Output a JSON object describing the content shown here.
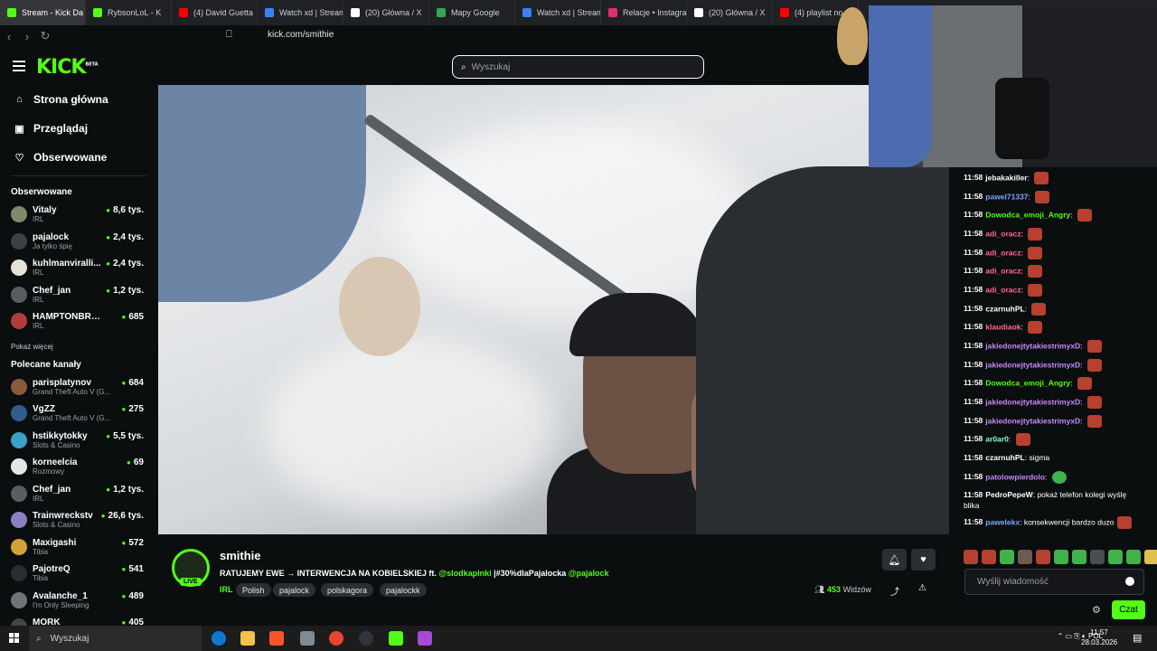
{
  "browser": {
    "tabs": [
      {
        "label": "Stream - Kick Da",
        "color": "#53fc18",
        "active": true
      },
      {
        "label": "RybsonLoL - K",
        "color": "#53fc18"
      },
      {
        "label": "(4) David Guetta",
        "color": "#ff0000"
      },
      {
        "label": "Watch xd | Stream",
        "color": "#3b82f6"
      },
      {
        "label": "(20) Główna / X",
        "color": "#ffffff"
      },
      {
        "label": "Mapy Google",
        "color": "#34a853"
      },
      {
        "label": "Watch xd | Stream",
        "color": "#3b82f6"
      },
      {
        "label": "Relacje • Instagram",
        "color": "#e1306c"
      },
      {
        "label": "(20) Główna / X",
        "color": "#ffffff"
      },
      {
        "label": "(4) playlist no",
        "color": "#ff0000"
      }
    ],
    "url": "kick.com/smithie"
  },
  "header": {
    "logo": "KICK",
    "logo_badge": "BETA",
    "search_placeholder": "Wyszukaj"
  },
  "sidebar": {
    "nav": [
      {
        "label": "Strona główna",
        "icon": "home-icon"
      },
      {
        "label": "Przeglądaj",
        "icon": "browse-icon"
      },
      {
        "label": "Obserwowane",
        "icon": "heart-icon"
      }
    ],
    "following_title": "Obserwowane",
    "following": [
      {
        "name": "Vitaly",
        "sub": "IRL",
        "viewers": "8,6 tys.",
        "color": "#7d8a6e"
      },
      {
        "name": "pajalock",
        "sub": "Ja tylko śpię",
        "viewers": "2,4 tys.",
        "color": "#3d3f44"
      },
      {
        "name": "kuhlmanviralli...",
        "sub": "IRL",
        "viewers": "2,4 tys.",
        "color": "#e8e2d6"
      },
      {
        "name": "Chef_jan",
        "sub": "IRL",
        "viewers": "1,2 tys.",
        "color": "#595c61"
      },
      {
        "name": "HAMPTONBRANDO",
        "sub": "IRL",
        "viewers": "685",
        "color": "#b23b3b"
      }
    ],
    "show_more": "Pokaż więcej",
    "recommended_title": "Polecane kanały",
    "recommended": [
      {
        "name": "parisplatynov",
        "sub": "Grand Theft Auto V (G...",
        "viewers": "684",
        "color": "#8c5a3a"
      },
      {
        "name": "VgZZ",
        "sub": "Grand Theft Auto V (G...",
        "viewers": "275",
        "color": "#2f5f8a"
      },
      {
        "name": "hstikkytokky",
        "sub": "Slots & Casino",
        "viewers": "5,5 tys.",
        "color": "#3aa0c8"
      },
      {
        "name": "korneelcia",
        "sub": "Rozmowy",
        "viewers": "69",
        "color": "#e6e6e6"
      },
      {
        "name": "Chef_jan",
        "sub": "IRL",
        "viewers": "1,2 tys.",
        "color": "#595c61"
      },
      {
        "name": "Trainwreckstv",
        "sub": "Slots & Casino",
        "viewers": "26,6 tys.",
        "color": "#8a7fc0"
      },
      {
        "name": "Maxigashi",
        "sub": "Tibia",
        "viewers": "572",
        "color": "#d2a23a"
      },
      {
        "name": "PajotreQ",
        "sub": "Tibia",
        "viewers": "541",
        "color": "#2a2c30"
      },
      {
        "name": "Avalanche_1",
        "sub": "I'm Only Sleeping",
        "viewers": "489",
        "color": "#6f747a"
      },
      {
        "name": "MORK",
        "sub": "",
        "viewers": "405",
        "color": "#444"
      }
    ]
  },
  "chat": {
    "messages": [
      {
        "time": "11:58",
        "user": "jebakakiller",
        "color": "#ffffff",
        "text": "",
        "emote": "red"
      },
      {
        "time": "11:58",
        "user": "pawel71337",
        "color": "#7aa7ff",
        "text": "",
        "emote": "red"
      },
      {
        "time": "11:58",
        "user": "Dowodca_emoji_Angry",
        "color": "#53fc18",
        "text": "",
        "emote": "red"
      },
      {
        "time": "11:58",
        "user": "adi_oracz",
        "color": "#ff6b8a",
        "text": "",
        "emote": "red"
      },
      {
        "time": "11:58",
        "user": "adi_oracz",
        "color": "#ff6b8a",
        "text": "",
        "emote": "red"
      },
      {
        "time": "11:58",
        "user": "adi_oracz",
        "color": "#ff6b8a",
        "text": "",
        "emote": "red"
      },
      {
        "time": "11:58",
        "user": "adi_oracz",
        "color": "#ff6b8a",
        "text": "",
        "emote": "red"
      },
      {
        "time": "11:58",
        "user": "czarnuhPL",
        "color": "#ffffff",
        "text": "",
        "emote": "red"
      },
      {
        "time": "11:58",
        "user": "klaudiaok",
        "color": "#ff6b8a",
        "text": "",
        "emote": "red"
      },
      {
        "time": "11:58",
        "user": "jakiedonejtytakiestrimyxD",
        "color": "#c58aff",
        "text": "",
        "emote": "red"
      },
      {
        "time": "11:58",
        "user": "jakiedonejtytakiestrimyxD",
        "color": "#c58aff",
        "text": "",
        "emote": "red"
      },
      {
        "time": "11:58",
        "user": "Dowodca_emoji_Angry",
        "color": "#53fc18",
        "text": "",
        "emote": "red"
      },
      {
        "time": "11:58",
        "user": "jakiedonejtytakiestrimyxD",
        "color": "#c58aff",
        "text": "",
        "emote": "red"
      },
      {
        "time": "11:58",
        "user": "jakiedonejtytakiestrimyxD",
        "color": "#c58aff",
        "text": "",
        "emote": "red"
      },
      {
        "time": "11:58",
        "user": "ar0ar0",
        "color": "#7fffd4",
        "text": "",
        "emote": "red"
      },
      {
        "time": "11:58",
        "user": "czarnuhPL",
        "color": "#ffffff",
        "text": "sigma",
        "emote": ""
      },
      {
        "time": "11:58",
        "user": "patolowpierdolo",
        "color": "#c58aff",
        "text": "",
        "emote": "green"
      },
      {
        "time": "11:58",
        "user": "PedroPepeW",
        "color": "#ffffff",
        "text": "pokaż telefon kolegi wyślę blika",
        "emote": ""
      },
      {
        "time": "11:58",
        "user": "pawelekx",
        "color": "#7aa7ff",
        "text": "konsekwencji bardzo duzo",
        "emote": "red"
      }
    ],
    "input_placeholder": "Wyślij wiadomość",
    "send_label": "Czat"
  },
  "stream": {
    "name": "smithie",
    "live": "LIVE",
    "title_prefix": "RATUJEMY EWE → INTERWENCJA NA KOBIELSKIEJ ft. ",
    "title_mention1": "@slodkapinki",
    "title_middle": " |#30%dlaPajalocka ",
    "title_mention2": "@pajalock",
    "category": "IRL",
    "tags": [
      "Polish",
      "pajalock",
      "polskagora",
      "pajalockk"
    ],
    "viewers": "453",
    "viewers_label": "Widzów"
  },
  "taskbar": {
    "search": "Wyszukaj",
    "lang": "POL",
    "time": "11:57",
    "date": "28.03.2026"
  }
}
